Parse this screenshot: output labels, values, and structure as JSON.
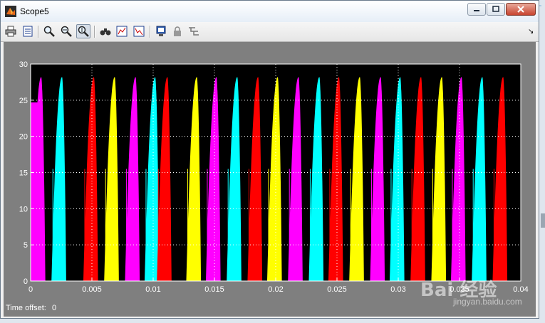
{
  "window": {
    "title": "Scope5",
    "icon": "matlab-icon",
    "controls": [
      "minimize-icon",
      "maximize-icon",
      "close-icon"
    ]
  },
  "toolbar": {
    "buttons": [
      {
        "icon": "print-icon"
      },
      {
        "icon": "parameters-icon"
      },
      {
        "icon": "zoom-icon"
      },
      {
        "icon": "zoom-x-icon"
      },
      {
        "icon": "zoom-y-icon",
        "pressed": true
      },
      {
        "icon": "autoscale-icon"
      },
      {
        "icon": "save-axes-icon"
      },
      {
        "icon": "restore-axes-icon"
      },
      {
        "icon": "floating-scope-icon"
      },
      {
        "icon": "lock-icon"
      },
      {
        "icon": "signal-selection-icon"
      }
    ],
    "dock_arrow": "↘"
  },
  "status": {
    "time_offset_label": "Time offset:",
    "time_offset_value": "0"
  },
  "watermark": {
    "brand": "Bai 经验",
    "url": "jingyan.baidu.com"
  },
  "colors": {
    "figure_bg": "#7f7f7f",
    "axes_bg": "#000000",
    "grid": "#ffffff",
    "series": [
      "#ff00ff",
      "#00ffff",
      "#ff0000",
      "#ffff00"
    ]
  },
  "chart_data": {
    "type": "area",
    "title": "",
    "xlabel": "",
    "ylabel": "",
    "xlim": [
      0,
      0.04
    ],
    "ylim": [
      0,
      30
    ],
    "xticks": [
      "0",
      "0.005",
      "0.01",
      "0.015",
      "0.02",
      "0.025",
      "0.03",
      "0.035",
      "0.04"
    ],
    "xtick_values": [
      0,
      0.005,
      0.01,
      0.015,
      0.02,
      0.025,
      0.03,
      0.035,
      0.04
    ],
    "yticks": [
      "0",
      "5",
      "10",
      "15",
      "20",
      "25",
      "30"
    ],
    "ytick_values": [
      0,
      5,
      10,
      15,
      20,
      25,
      30
    ],
    "grid": true,
    "peak_value": 28.2,
    "pulse_period": 0.00167,
    "pulse_width": 0.0012,
    "color_cycle": [
      "#00ffff",
      "#ff0000",
      "#ffff00",
      "#ff00ff"
    ],
    "series": [
      {
        "color": "#ff00ff",
        "pulse_starts": [
          0.0,
          0.0077,
          0.0143,
          0.021,
          0.0277,
          0.0343
        ]
      },
      {
        "color": "#00ffff",
        "pulse_starts": [
          0.0017,
          0.0093,
          0.016,
          0.0227,
          0.0293,
          0.036
        ]
      },
      {
        "color": "#ff0000",
        "pulse_starts": [
          0.0043,
          0.0103,
          0.0177,
          0.0243,
          0.031,
          0.0377
        ]
      },
      {
        "color": "#ffff00",
        "pulse_starts": [
          0.006,
          0.0127,
          0.0193,
          0.026,
          0.0327
        ]
      }
    ],
    "initial_level": 24.7
  }
}
